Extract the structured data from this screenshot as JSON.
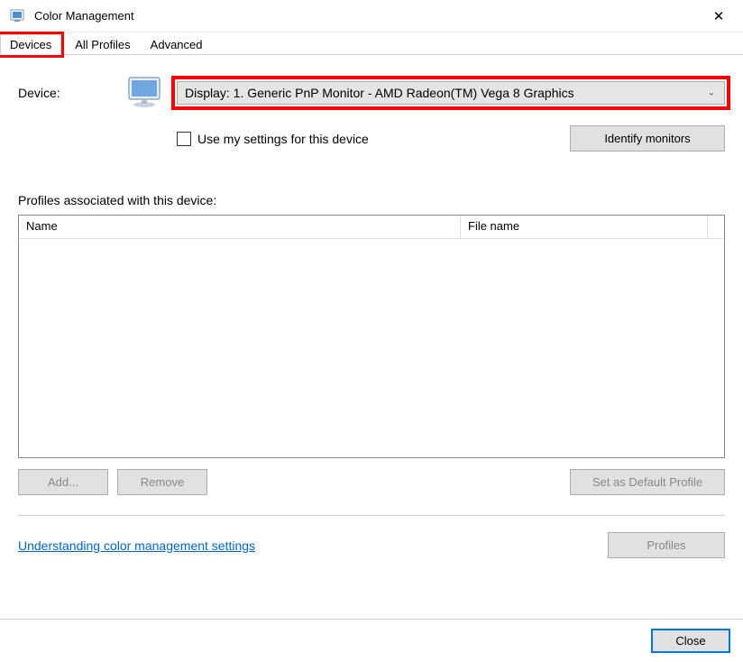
{
  "window": {
    "title": "Color Management"
  },
  "tabs": {
    "items": [
      {
        "label": "Devices",
        "active": true,
        "highlighted": true
      },
      {
        "label": "All Profiles",
        "active": false,
        "highlighted": false
      },
      {
        "label": "Advanced",
        "active": false,
        "highlighted": false
      }
    ]
  },
  "device": {
    "label": "Device:",
    "dropdown_value": "Display: 1. Generic PnP Monitor - AMD Radeon(TM) Vega 8 Graphics",
    "use_settings_label": "Use my settings for this device",
    "identify_button": "Identify monitors"
  },
  "profiles": {
    "section_label": "Profiles associated with this device:",
    "columns": {
      "name": "Name",
      "file": "File name"
    },
    "add_button": "Add...",
    "remove_button": "Remove",
    "default_button": "Set as Default Profile"
  },
  "bottom": {
    "link": "Understanding color management settings",
    "profiles_button": "Profiles"
  },
  "footer": {
    "close_button": "Close"
  }
}
